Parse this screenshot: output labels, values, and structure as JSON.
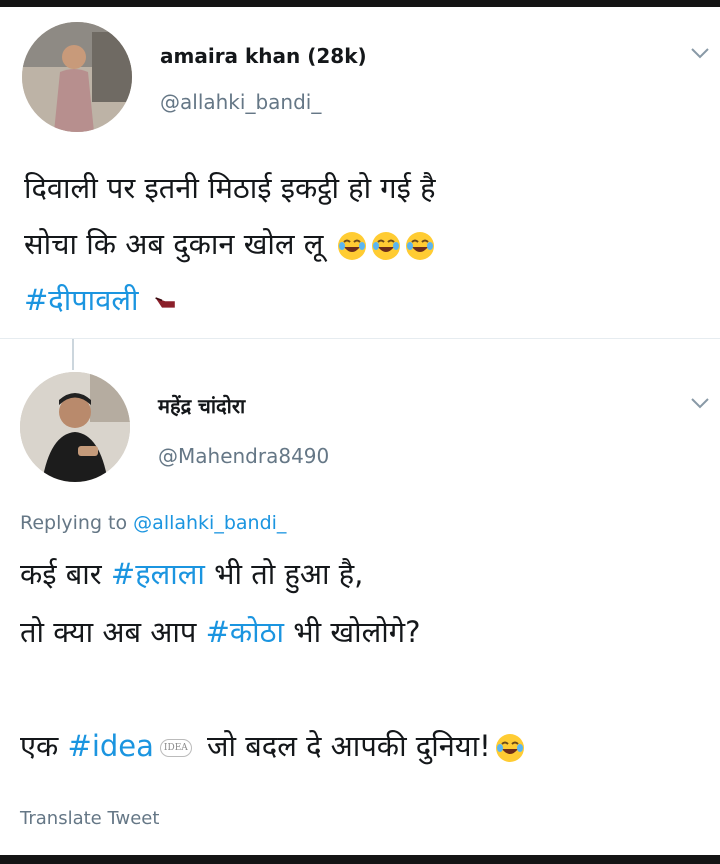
{
  "tweet1": {
    "display_name": "amaira khan (28k)",
    "handle": "@allahki_bandi_",
    "line1": "दिवाली पर इतनी मिठाई इकट्ठी हो गई है",
    "line2": "सोचा कि अब दुकान खोल लू",
    "hashtag": "#दीपावली"
  },
  "tweet2": {
    "display_name": "महेंद्र चांदोरा",
    "handle": "@Mahendra8490",
    "replying_prefix": "Replying to",
    "replying_to": "@allahki_bandi_",
    "l1_a": "कई बार ",
    "l1_tag": "#हलाला",
    "l1_b": " भी तो हुआ है,",
    "l2_a": "तो क्या अब आप ",
    "l2_tag": "#कोठा",
    "l2_b": " भी खोलोगे?",
    "l3_a": "एक ",
    "l3_tag": "#idea",
    "l3_badge": "IDEA",
    "l3_b": " जो बदल दे आपकी दुनिया!",
    "translate": "Translate Tweet"
  },
  "icons": [
    "chevron-down-icon",
    "laughing-emoji-icon",
    "pointing-hand-icon"
  ],
  "colors": {
    "link": "#1b95e0",
    "secondary": "#657786",
    "text": "#14171a"
  }
}
